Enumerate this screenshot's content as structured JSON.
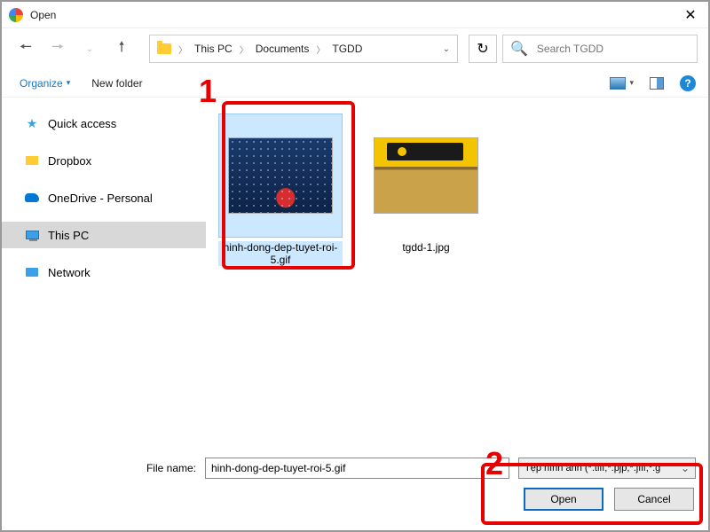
{
  "title": "Open",
  "breadcrumb": {
    "root": "This PC",
    "mid": "Documents",
    "leaf": "TGDD"
  },
  "search": {
    "placeholder": "Search TGDD"
  },
  "toolbar": {
    "organize": "Organize",
    "newfolder": "New folder"
  },
  "sidebar": {
    "items": [
      {
        "label": "Quick access"
      },
      {
        "label": "Dropbox"
      },
      {
        "label": "OneDrive - Personal"
      },
      {
        "label": "This PC"
      },
      {
        "label": "Network"
      }
    ]
  },
  "files": [
    {
      "name": "hinh-dong-dep-tuyet-roi-5.gif"
    },
    {
      "name": "tgdd-1.jpg"
    }
  ],
  "footer": {
    "label": "File name:",
    "value": "hinh-dong-dep-tuyet-roi-5.gif",
    "filter": "Tệp hình ảnh (*.tiff;*.pjp;*.jfif;*.g",
    "open": "Open",
    "cancel": "Cancel"
  },
  "callouts": {
    "one": "1",
    "two": "2"
  }
}
